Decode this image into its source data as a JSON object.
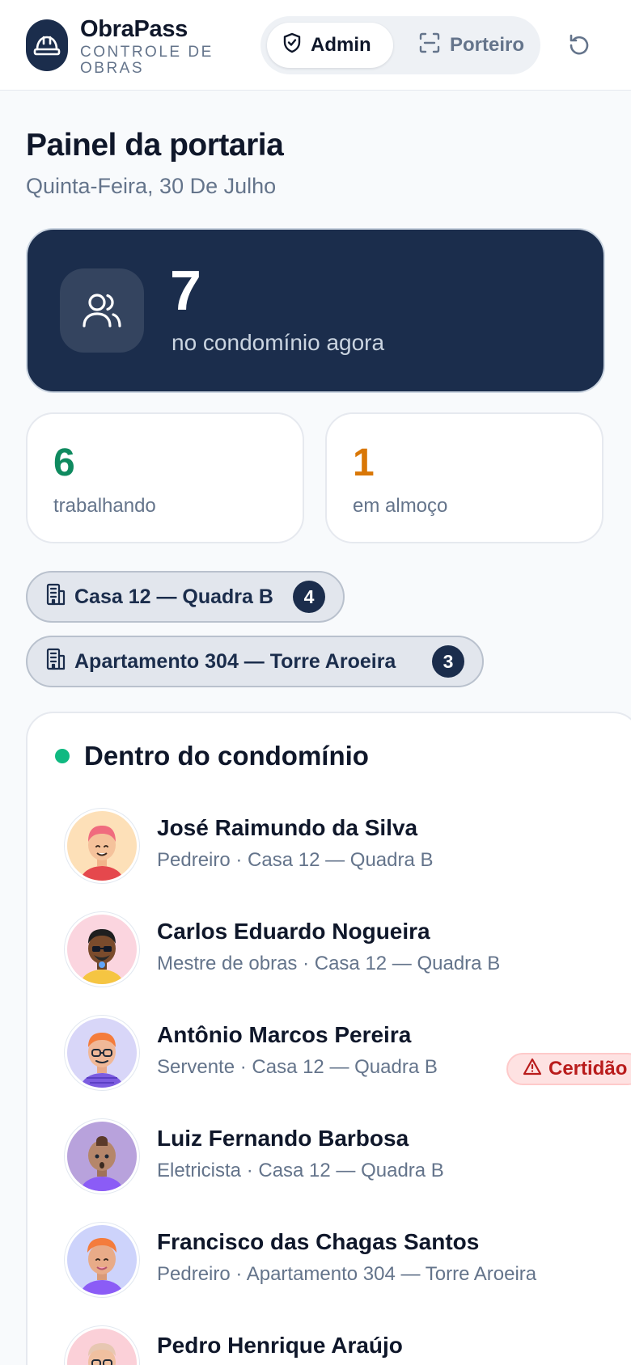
{
  "app": {
    "name": "ObraPass",
    "subtitle": "CONTROLE DE OBRAS"
  },
  "roles": {
    "admin_label": "Admin",
    "porteiro_label": "Porteiro",
    "active": "Admin"
  },
  "page": {
    "title": "Painel da portaria",
    "date": "Quinta-Feira, 30 De Julho"
  },
  "hero": {
    "count": "7",
    "label": "no condomínio agora"
  },
  "stats": {
    "working": {
      "value": "6",
      "label": "trabalhando",
      "color": "#0f8a5f"
    },
    "lunch": {
      "value": "1",
      "label": "em almoço",
      "color": "#d97706"
    }
  },
  "units": [
    {
      "label": "Casa 12 — Quadra B",
      "count": "4"
    },
    {
      "label": "Apartamento 304 — Torre Aroeira",
      "count": "3"
    }
  ],
  "inside": {
    "title": "Dentro do condomínio",
    "people": [
      {
        "name": "José Raimundo da Silva",
        "meta": "Pedreiro · Casa 12 — Quadra B"
      },
      {
        "name": "Carlos Eduardo Nogueira",
        "meta": "Mestre de obras · Casa 12 — Quadra B"
      },
      {
        "name": "Antônio Marcos Pereira",
        "meta": "Servente · Casa 12 — Quadra B",
        "warning": "Certidão"
      },
      {
        "name": "Luiz Fernando Barbosa",
        "meta": "Eletricista · Casa 12 — Quadra B"
      },
      {
        "name": "Francisco das Chagas Santos",
        "meta": "Pedreiro · Apartamento 304 — Torre Aroeira"
      },
      {
        "name": "Pedro Henrique Araújo",
        "meta": ""
      }
    ]
  },
  "colors": {
    "navy": "#1b2d4c",
    "accent_green": "#10b981",
    "warning_red": "#b91c1c"
  }
}
